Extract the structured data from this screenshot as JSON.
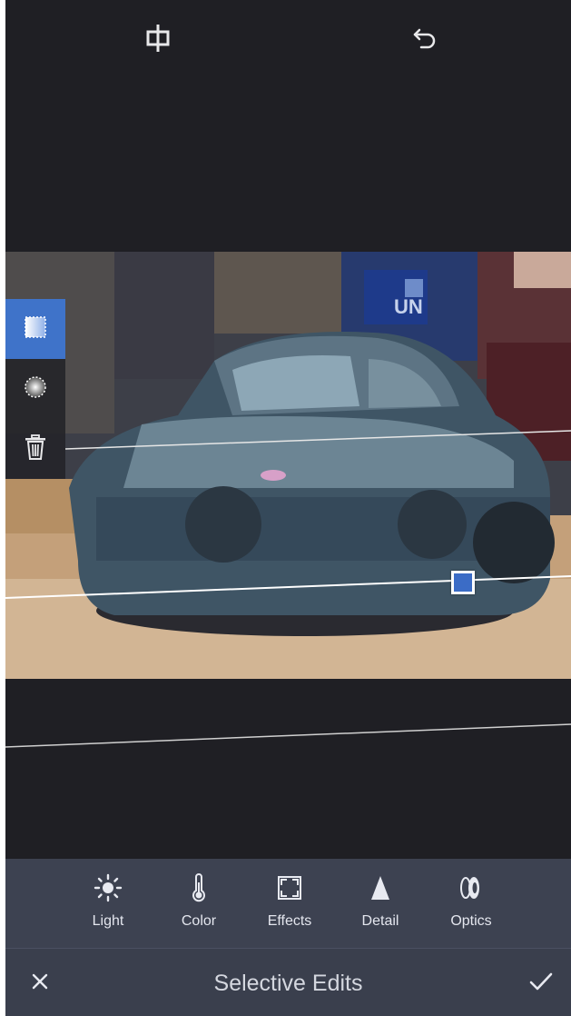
{
  "top_bar": {
    "compare_icon": "compare-icon",
    "undo_icon": "undo-icon"
  },
  "photo": {
    "subject": "painted vintage car",
    "sign_text": "UN"
  },
  "mask_tools": [
    {
      "name": "linear-gradient",
      "icon": "linear-gradient-icon",
      "active": true
    },
    {
      "name": "radial-gradient",
      "icon": "radial-gradient-icon",
      "active": false
    },
    {
      "name": "delete",
      "icon": "trash-icon",
      "active": false
    }
  ],
  "toolbar": {
    "tools": [
      {
        "label": "Light",
        "icon": "sun-icon"
      },
      {
        "label": "Color",
        "icon": "thermometer-icon"
      },
      {
        "label": "Effects",
        "icon": "effects-icon"
      },
      {
        "label": "Detail",
        "icon": "detail-icon"
      },
      {
        "label": "Optics",
        "icon": "optics-icon"
      }
    ]
  },
  "footer": {
    "title": "Selective Edits",
    "cancel_icon": "close-icon",
    "confirm_icon": "checkmark-icon"
  },
  "colors": {
    "background": "#1f1f24",
    "accent": "#3f73c9",
    "toolbar": "#3d4251",
    "footer": "#3a3f4d"
  }
}
